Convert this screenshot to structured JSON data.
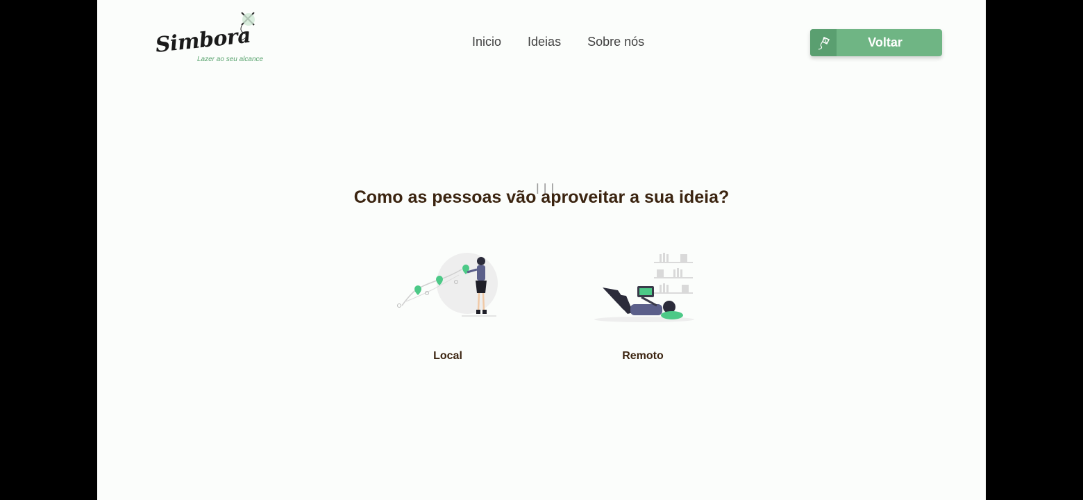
{
  "logo": {
    "wordmark": "Simbora",
    "tagline": "Lazer ao seu alcance",
    "icon": "kite-icon"
  },
  "nav": {
    "items": [
      {
        "label": "Inicio"
      },
      {
        "label": "Ideias"
      },
      {
        "label": "Sobre nós"
      }
    ]
  },
  "back_button": {
    "label": "Voltar",
    "icon": "kite-icon"
  },
  "main": {
    "question": "Como as pessoas vão aproveitar a sua ideia?",
    "options": [
      {
        "label": "Local",
        "illustration": "map-pins-woman-illustration"
      },
      {
        "label": "Remoto",
        "illustration": "person-laptop-illustration"
      }
    ]
  },
  "colors": {
    "accent": "#6fb584",
    "accent_dark": "#5a9f70",
    "heading": "#3b2410",
    "background": "#fbfdfb",
    "pin": "#4cc987"
  }
}
